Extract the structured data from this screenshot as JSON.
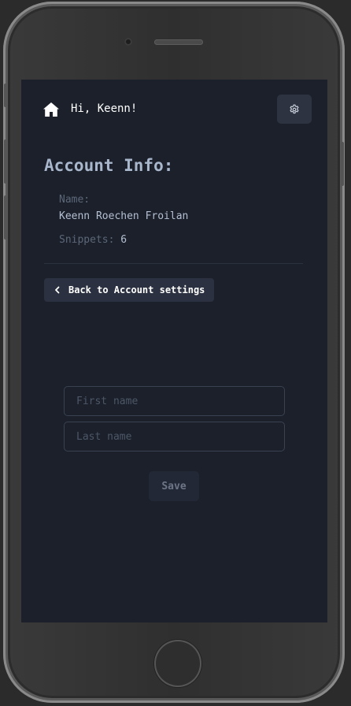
{
  "header": {
    "greeting": "Hi, Keenn!",
    "home_icon": "home-icon",
    "settings_icon": "gear-icon"
  },
  "account": {
    "title": "Account Info:",
    "name_label": "Name:",
    "name_value": "Keenn Roechen Froilan",
    "snippets_label": "Snippets:",
    "snippets_value": "6"
  },
  "back_button": {
    "label": "Back to Account settings",
    "icon": "chevron-left-icon"
  },
  "form": {
    "first_name_placeholder": "First name",
    "first_name_value": "",
    "last_name_placeholder": "Last name",
    "last_name_value": "",
    "save_label": "Save"
  },
  "colors": {
    "screen_background": "#1b202b",
    "title": "#a9b7cd",
    "label": "#5c6778",
    "value": "#b4c0d2",
    "button_background": "#2b3140"
  }
}
